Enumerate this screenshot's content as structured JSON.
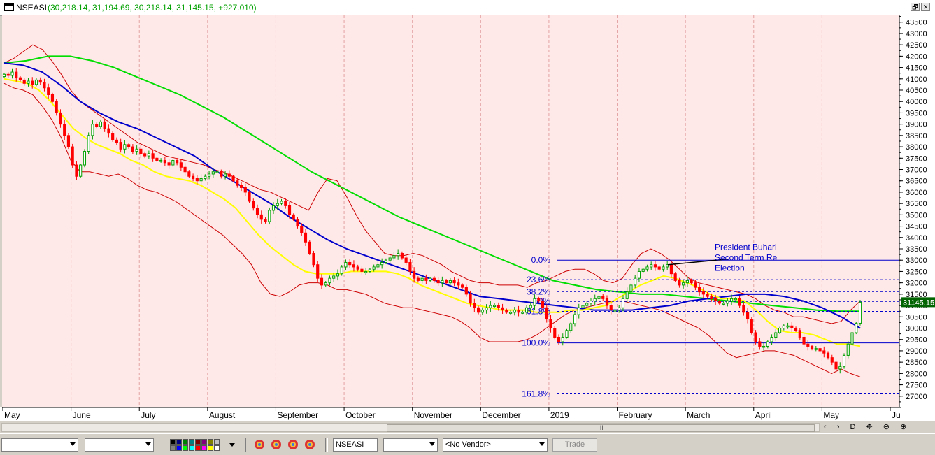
{
  "window": {
    "symbol": "NSEASI",
    "ohlc_text": "(30,218.14, 31,194.69, 30,218.14, 31,145.15, +927.010)",
    "restore_label": "🗗",
    "close_label": "✕"
  },
  "chart_data": {
    "type": "candlestick",
    "symbol": "NSEASI",
    "ylim": [
      26500,
      43800
    ],
    "y_ticks": [
      27000,
      27500,
      28000,
      28500,
      29000,
      29500,
      30000,
      30500,
      31000,
      31500,
      32000,
      32500,
      33000,
      33500,
      34000,
      34500,
      35000,
      35500,
      36000,
      36500,
      37000,
      37500,
      38000,
      38500,
      39000,
      39500,
      40000,
      40500,
      41000,
      41500,
      42000,
      42500,
      43000,
      43500
    ],
    "x_labels": [
      "May",
      "June",
      "July",
      "August",
      "September",
      "October",
      "November",
      "December",
      "2019",
      "February",
      "March",
      "April",
      "May",
      "Ju"
    ],
    "last_price_label": "31145.15",
    "last_price": 31145.15,
    "colors": {
      "up": "#00a000",
      "down": "#ff0000",
      "ma_short": "#ffff00",
      "ma_mid": "#0000cc",
      "ma_long": "#00dd00",
      "band": "#cc0000",
      "fib": "#0000cc",
      "background": "#ffe8e8"
    },
    "close_series": [
      41200,
      41150,
      41300,
      41050,
      40950,
      40800,
      40900,
      40750,
      40950,
      40850,
      40600,
      40300,
      40000,
      39500,
      39000,
      38500,
      38000,
      37200,
      36700,
      37200,
      37800,
      38500,
      39000,
      38900,
      39100,
      38800,
      38600,
      38300,
      38200,
      37900,
      38100,
      38000,
      37800,
      37900,
      37700,
      37600,
      37700,
      37500,
      37400,
      37400,
      37300,
      37200,
      37400,
      37300,
      37100,
      36900,
      36700,
      36600,
      36500,
      36600,
      36700,
      36800,
      36900,
      36900,
      36700,
      36800,
      36700,
      36500,
      36300,
      36200,
      36000,
      35600,
      35300,
      35000,
      34800,
      34700,
      35200,
      35400,
      35500,
      35600,
      35400,
      35000,
      34800,
      34500,
      34200,
      33800,
      33300,
      32800,
      32200,
      31900,
      32000,
      32200,
      32300,
      32400,
      32700,
      32900,
      32800,
      32700,
      32600,
      32500,
      32500,
      32600,
      32700,
      32800,
      32900,
      33000,
      33100,
      33200,
      33300,
      33100,
      32900,
      32500,
      32200,
      32100,
      32200,
      32100,
      32200,
      32100,
      32000,
      32100,
      32000,
      32100,
      32000,
      31900,
      31800,
      31500,
      31100,
      30900,
      30700,
      30800,
      30900,
      31000,
      31000,
      30900,
      30800,
      30700,
      30700,
      30800,
      30700,
      30700,
      30900,
      31000,
      31300,
      31200,
      30900,
      30400,
      30000,
      29600,
      29400,
      29600,
      29900,
      30200,
      30600,
      30900,
      31000,
      31100,
      31200,
      31300,
      31400,
      31300,
      31000,
      30800,
      30800,
      30900,
      31300,
      31600,
      31900,
      32200,
      32500,
      32600,
      32700,
      32800,
      32700,
      32600,
      32700,
      32800,
      32400,
      32100,
      31900,
      32000,
      32100,
      32000,
      31800,
      31600,
      31500,
      31400,
      31300,
      31200,
      31100,
      31100,
      31200,
      31300,
      31300,
      31000,
      30700,
      30400,
      29800,
      29400,
      29200,
      29200,
      29400,
      29600,
      29800,
      30000,
      30100,
      30100,
      30000,
      29900,
      29600,
      29300,
      29200,
      29100,
      29100,
      29000,
      28900,
      28700,
      28500,
      28200,
      28300,
      28800,
      29300,
      29800,
      30218,
      31145
    ],
    "bollinger_upper": [
      41700,
      41900,
      42200,
      42500,
      42300,
      41800,
      41200,
      40500,
      40000,
      39700,
      39400,
      39100,
      38800,
      38500,
      38200,
      38000,
      37800,
      37600,
      37500,
      37400,
      37300,
      37200,
      37000,
      36900,
      36700,
      36500,
      36300,
      36100,
      36000,
      35800,
      35600,
      35400,
      35200,
      36000,
      36600,
      36500,
      35800,
      35000,
      34300,
      33800,
      33300,
      33200,
      33200,
      33300,
      33200,
      33000,
      32800,
      32500,
      32300,
      32100,
      32000,
      32000,
      31900,
      31900,
      31900,
      31800,
      32000,
      32100,
      32300,
      32500,
      32600,
      32600,
      32400,
      32100,
      32000,
      32200,
      32800,
      33300,
      33500,
      33300,
      33000,
      32600,
      32200,
      32000,
      31900,
      31800,
      31700,
      31600,
      31500,
      31300,
      31000,
      30800,
      30700,
      30500,
      30500,
      30400,
      30300,
      30200,
      30300,
      30800,
      31200
    ],
    "bollinger_lower": [
      40800,
      40600,
      40500,
      40300,
      39800,
      39200,
      38400,
      37400,
      36900,
      36900,
      36800,
      36700,
      36800,
      36600,
      36300,
      36100,
      36000,
      35800,
      35600,
      35300,
      35000,
      34700,
      34400,
      34100,
      33700,
      33300,
      32800,
      32000,
      31500,
      31400,
      31600,
      31900,
      32000,
      32000,
      31900,
      31700,
      31700,
      31600,
      31500,
      31300,
      31100,
      31000,
      30900,
      30900,
      30800,
      30700,
      30600,
      30500,
      30300,
      30000,
      29600,
      29400,
      29400,
      29400,
      29400,
      29500,
      29700,
      30000,
      30300,
      30600,
      30800,
      30900,
      31000,
      31100,
      31200,
      31200,
      31100,
      31000,
      30900,
      30800,
      30600,
      30400,
      30200,
      30000,
      29700,
      29300,
      28900,
      28700,
      28800,
      28900,
      29000,
      29000,
      28900,
      28800,
      28600,
      28400,
      28200,
      28000,
      28200,
      28000,
      27850
    ],
    "ma_short": [
      41000,
      40900,
      40800,
      40500,
      40000,
      39400,
      38800,
      38400,
      38100,
      37900,
      37700,
      37400,
      37200,
      36900,
      36700,
      36600,
      36500,
      36300,
      36000,
      35700,
      35300,
      34700,
      34100,
      33600,
      33200,
      32800,
      32500,
      32400,
      32400,
      32400,
      32500,
      32500,
      32500,
      32500,
      32400,
      32200,
      31900,
      31700,
      31500,
      31300,
      31100,
      31000,
      30900,
      30800,
      30800,
      30800,
      30700,
      30700,
      30700,
      30800,
      30800,
      30900,
      31000,
      31300,
      31600,
      31900,
      32100,
      32300,
      32200,
      32000,
      31800,
      31500,
      31300,
      31300,
      31200,
      30800,
      30300,
      29900,
      29800,
      29800,
      29700,
      29500,
      29300,
      29300,
      29200
    ],
    "ma_mid": [
      41700,
      41600,
      41300,
      40700,
      40000,
      39500,
      39100,
      38800,
      38400,
      38000,
      37600,
      37000,
      36500,
      36000,
      35500,
      34900,
      34400,
      33900,
      33500,
      33200,
      32900,
      32600,
      32300,
      32000,
      31700,
      31400,
      31300,
      31200,
      31100,
      31000,
      30900,
      30800,
      30800,
      30800,
      30900,
      31000,
      31200,
      31300,
      31400,
      31500,
      31500,
      31400,
      31200,
      30900,
      30500,
      30000
    ],
    "ma_long": [
      41700,
      41800,
      42000,
      42000,
      41800,
      41500,
      41100,
      40700,
      40300,
      39800,
      39300,
      38700,
      38100,
      37500,
      36900,
      36400,
      35900,
      35400,
      34900,
      34500,
      34100,
      33700,
      33300,
      32900,
      32500,
      32100,
      31900,
      31700,
      31600,
      31500,
      31500,
      31400,
      31300,
      31200,
      31100,
      31000,
      30900,
      30800,
      30750,
      30750
    ],
    "fibonacci": {
      "high": 33000,
      "low": 29350,
      "levels": [
        {
          "label": "0.0%",
          "value": 33000
        },
        {
          "label": "23.6%",
          "value": 32140
        },
        {
          "label": "38.2%",
          "value": 31610
        },
        {
          "label": "50%",
          "value": 31180
        },
        {
          "label": "61.8%",
          "value": 30740
        },
        {
          "label": "100.0%",
          "value": 29350
        },
        {
          "label": "161.8%",
          "value": 27100
        }
      ]
    },
    "annotation": {
      "text_lines": [
        "President Buhari",
        "Second Term Re",
        "Election"
      ]
    }
  },
  "bottom_bar": {
    "symbol_field": "NSEASI",
    "vendor_select": "<No Vendor>",
    "trade_button": "Trade",
    "scroll_thumb_label": "III",
    "scroll_tools": "‹ › D ✥ ⊖ ⊕"
  }
}
